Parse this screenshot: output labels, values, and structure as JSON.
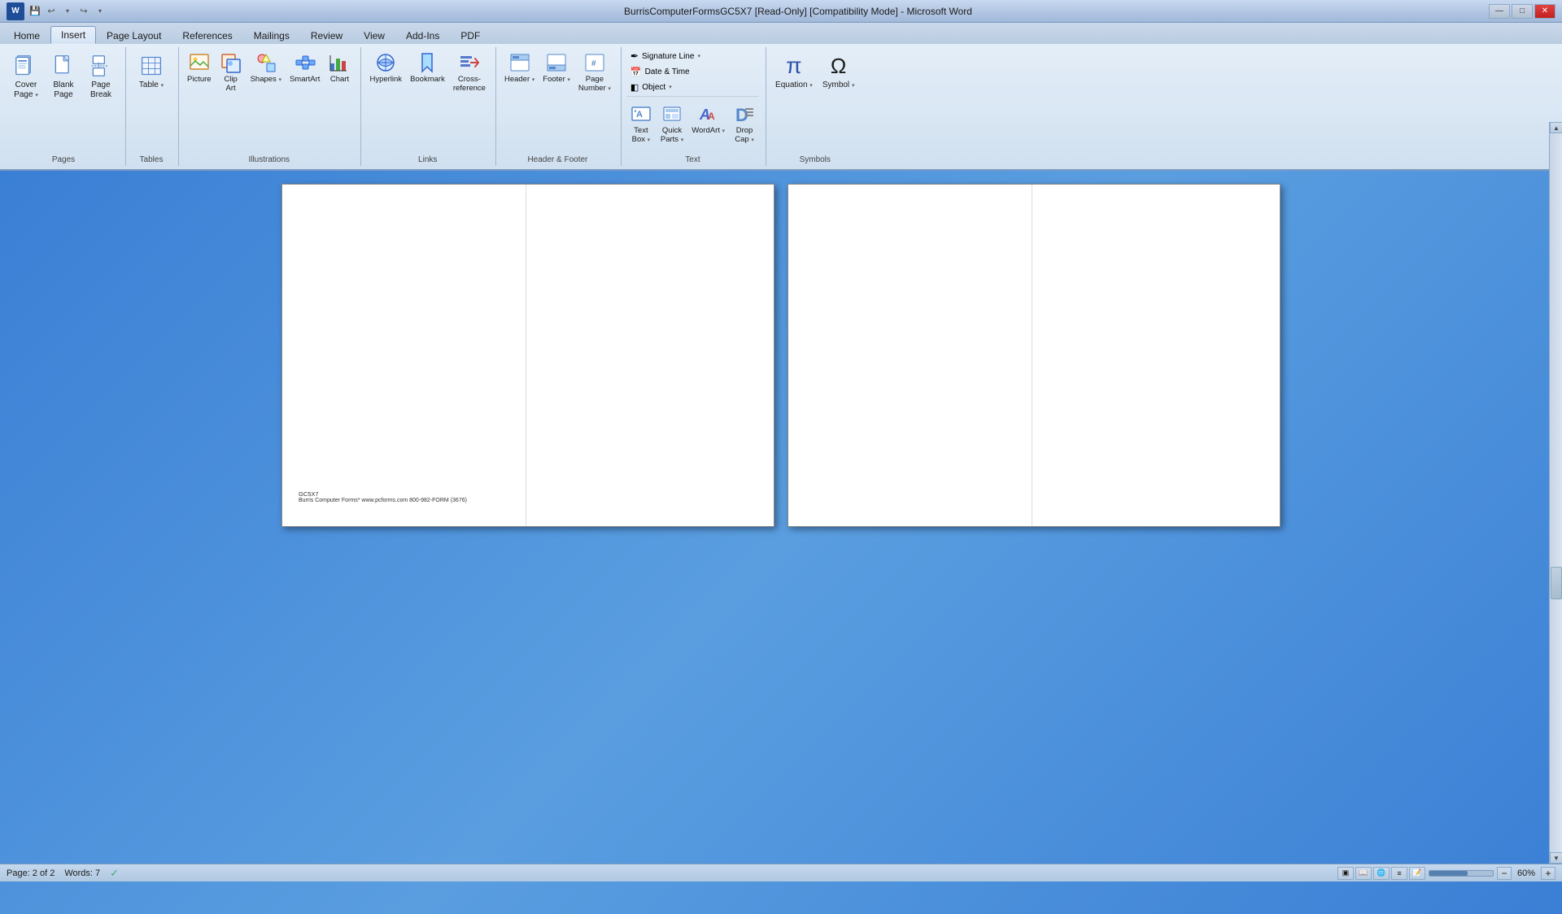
{
  "titlebar": {
    "title": "BurrisComputerFormsGC5X7 [Read-Only] [Compatibility Mode] - Microsoft Word",
    "min": "—",
    "max": "□",
    "close": "✕"
  },
  "quickaccess": {
    "save": "💾",
    "undo": "↩",
    "redo": "↪",
    "dropdown": "▾"
  },
  "tabs": [
    "Home",
    "Insert",
    "Page Layout",
    "References",
    "Mailings",
    "Review",
    "View",
    "Add-Ins",
    "PDF"
  ],
  "activeTab": "Insert",
  "groups": {
    "pages": {
      "label": "Pages",
      "buttons": [
        {
          "name": "cover-page",
          "label": "Cover\nPage",
          "icon": "📄"
        },
        {
          "name": "blank-page",
          "label": "Blank\nPage",
          "icon": "📃"
        },
        {
          "name": "page-break",
          "label": "Page\nBreak",
          "icon": "📑"
        }
      ]
    },
    "tables": {
      "label": "Tables",
      "buttons": [
        {
          "name": "table",
          "label": "Table",
          "icon": "⊞"
        }
      ]
    },
    "illustrations": {
      "label": "Illustrations",
      "buttons": [
        {
          "name": "picture",
          "label": "Picture",
          "icon": "🖼"
        },
        {
          "name": "clip-art",
          "label": "Clip\nArt",
          "icon": "✂"
        },
        {
          "name": "shapes",
          "label": "Shapes",
          "icon": "△"
        },
        {
          "name": "smartart",
          "label": "SmartArt",
          "icon": "🔷"
        },
        {
          "name": "chart",
          "label": "Chart",
          "icon": "📊"
        }
      ]
    },
    "links": {
      "label": "Links",
      "buttons": [
        {
          "name": "hyperlink",
          "label": "Hyperlink",
          "icon": "🔗"
        },
        {
          "name": "bookmark",
          "label": "Bookmark",
          "icon": "🔖"
        },
        {
          "name": "cross-reference",
          "label": "Cross-\nreference",
          "icon": "↕"
        }
      ]
    },
    "header-footer": {
      "label": "Header & Footer",
      "buttons": [
        {
          "name": "header",
          "label": "Header",
          "icon": "▭"
        },
        {
          "name": "footer",
          "label": "Footer",
          "icon": "▬"
        },
        {
          "name": "page-number",
          "label": "Page\nNumber",
          "icon": "#"
        }
      ]
    },
    "text": {
      "label": "Text",
      "buttons": [
        {
          "name": "text-box",
          "label": "Text\nBox",
          "icon": "⬜"
        },
        {
          "name": "quick-parts",
          "label": "Quick\nParts",
          "icon": "⚙"
        },
        {
          "name": "wordart",
          "label": "WordArt",
          "icon": "A"
        },
        {
          "name": "drop-cap",
          "label": "Drop\nCap",
          "icon": "D"
        }
      ]
    },
    "symbols": {
      "label": "Symbols",
      "buttons": [
        {
          "name": "equation",
          "label": "Equation",
          "icon": "π"
        },
        {
          "name": "symbol",
          "label": "Symbol",
          "icon": "Ω"
        }
      ]
    }
  },
  "signatureLine": {
    "label": "Signature Line",
    "icon": "✒"
  },
  "dateTime": {
    "label": "Date & Time",
    "icon": "📅"
  },
  "object": {
    "label": "Object",
    "icon": "◧"
  },
  "page1": {
    "footerLine1": "GC5X7",
    "footerLine2": "Burris Computer Forms*  www.pcforms.com  800-982-FORM (3676)"
  },
  "statusbar": {
    "page": "Page: 2 of 2",
    "words": "Words: 7",
    "zoom": "60%"
  },
  "scrollbar": {
    "upArrow": "▲",
    "downArrow": "▼",
    "leftArrow": "◄",
    "rightArrow": "►"
  }
}
